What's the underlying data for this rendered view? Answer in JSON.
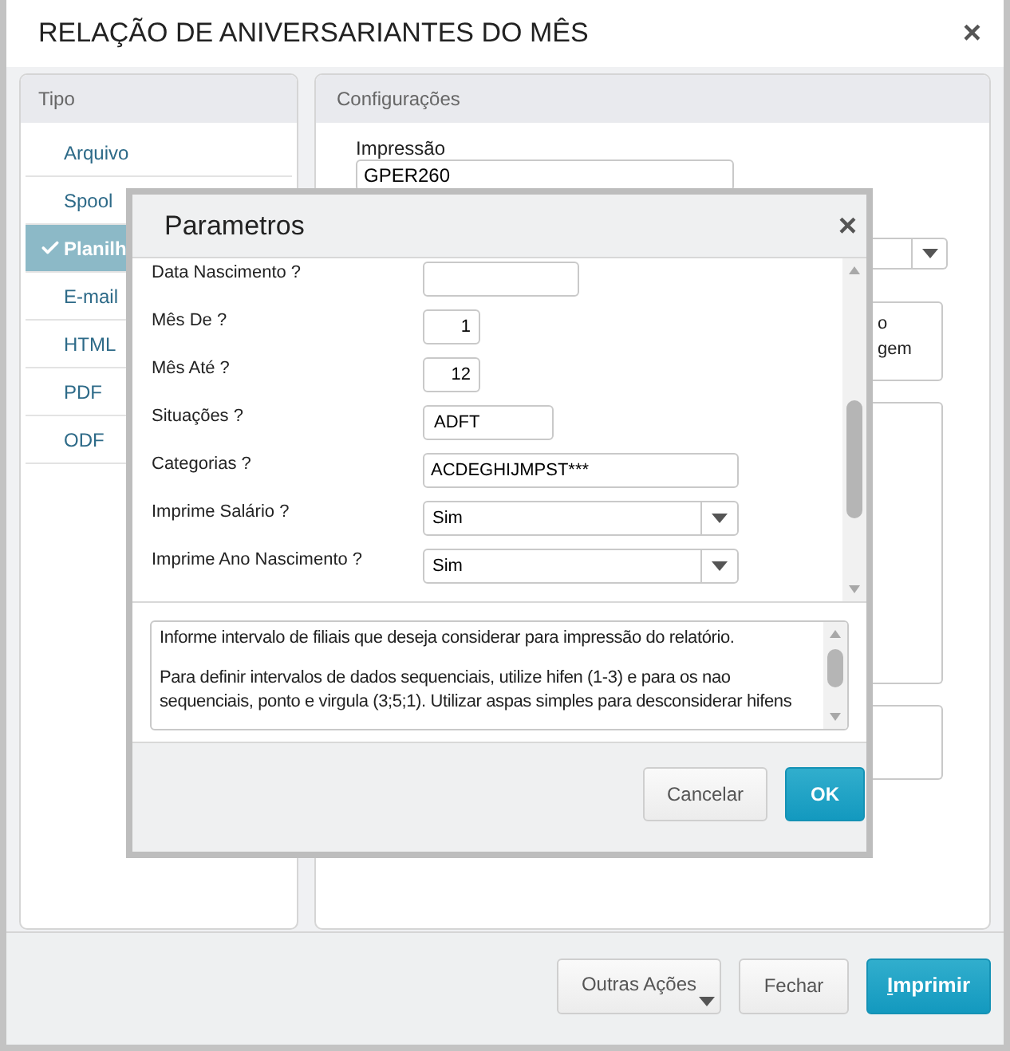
{
  "window": {
    "title": "RELAÇÃO DE ANIVERSARIANTES DO MÊS",
    "close": "×"
  },
  "tipo": {
    "title": "Tipo",
    "items": [
      {
        "label": "Arquivo",
        "selected": false
      },
      {
        "label": "Spool",
        "selected": false
      },
      {
        "label": "Planilh",
        "selected": true
      },
      {
        "label": "E-mail",
        "selected": false
      },
      {
        "label": "HTML",
        "selected": false
      },
      {
        "label": "PDF",
        "selected": false
      },
      {
        "label": "ODF",
        "selected": false
      }
    ]
  },
  "configuracoes": {
    "title": "Configurações",
    "impressao": {
      "label": "Impressão",
      "value": "GPER260"
    },
    "option_text": [
      "o",
      "gem"
    ]
  },
  "buttons": [
    {
      "label": "Outras Ações",
      "kind": "menu"
    },
    {
      "label": "Fechar",
      "kind": "default"
    },
    {
      "label": "Imprimir",
      "kind": "primary"
    }
  ],
  "dialog": {
    "title": "Parametros",
    "close": "×",
    "params": [
      {
        "label": "Data Nascimento ?",
        "kind": "date"
      },
      {
        "label": "Mês De ?",
        "kind": "number",
        "value": "1"
      },
      {
        "label": "Mês Até ?",
        "kind": "number",
        "value": "12"
      },
      {
        "label": "Situações ?",
        "kind": "code",
        "value": "ADFT"
      },
      {
        "label": "Categorias ?",
        "kind": "text",
        "value": "ACDEGHIJMPST***"
      },
      {
        "label": "Imprime Salário ?",
        "kind": "select",
        "value": "Sim"
      },
      {
        "label": "Imprime Ano Nascimento ?",
        "kind": "select",
        "value": "Sim"
      }
    ],
    "help": [
      "Informe intervalo de filiais que deseja considerar para impressão do relatório.",
      "Para definir intervalos de dados sequenciais, utilize hifen (1-3) e para os nao sequenciais, ponto e virgula (3;5;1). Utilizar aspas simples para desconsiderar hifens"
    ],
    "buttons": [
      {
        "label": "Cancelar",
        "kind": "default"
      },
      {
        "label": "OK",
        "kind": "primary"
      }
    ]
  }
}
